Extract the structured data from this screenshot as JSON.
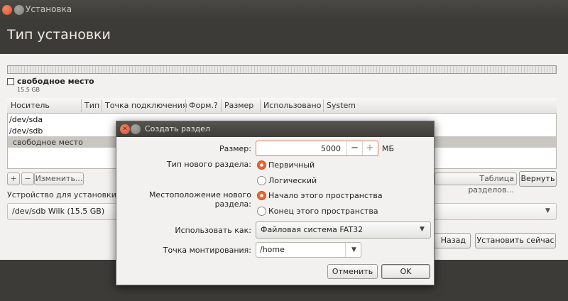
{
  "window": {
    "title": "Установка"
  },
  "page": {
    "title": "Тип установки"
  },
  "free_space": {
    "label": "свободное место",
    "size": "15.5 GB"
  },
  "table": {
    "headers": [
      "Носитель",
      "Тип",
      "Точка подключения",
      "Форм.?",
      "Размер",
      "Использовано",
      "System"
    ],
    "rows": [
      "/dev/sda",
      "/dev/sdb",
      "свободное место"
    ]
  },
  "table_buttons": {
    "add": "+",
    "remove": "−",
    "change": "Изменить...",
    "new_table": "Таблица разделов...",
    "revert": "Вернуть"
  },
  "device": {
    "label": "Устройство для установки с",
    "value": "/dev/sdb   Wilk  (15.5 GB)"
  },
  "footer": {
    "back": "Назад",
    "install": "Установить сейчас"
  },
  "dialog": {
    "title": "Создать раздел",
    "size_label": "Размер:",
    "size_value": "5000",
    "size_unit": "МБ",
    "spin_minus": "−",
    "spin_plus": "+",
    "type_label": "Тип нового раздела:",
    "type_options": [
      "Первичный",
      "Логический"
    ],
    "location_label": "Местоположение нового раздела:",
    "location_options": [
      "Начало этого пространства",
      "Конец этого пространства"
    ],
    "use_as_label": "Использовать как:",
    "use_as_value": "Файловая система FAT32",
    "mount_label": "Точка монтирования:",
    "mount_value": "/home",
    "cancel": "Отменить",
    "ok": "OK"
  }
}
